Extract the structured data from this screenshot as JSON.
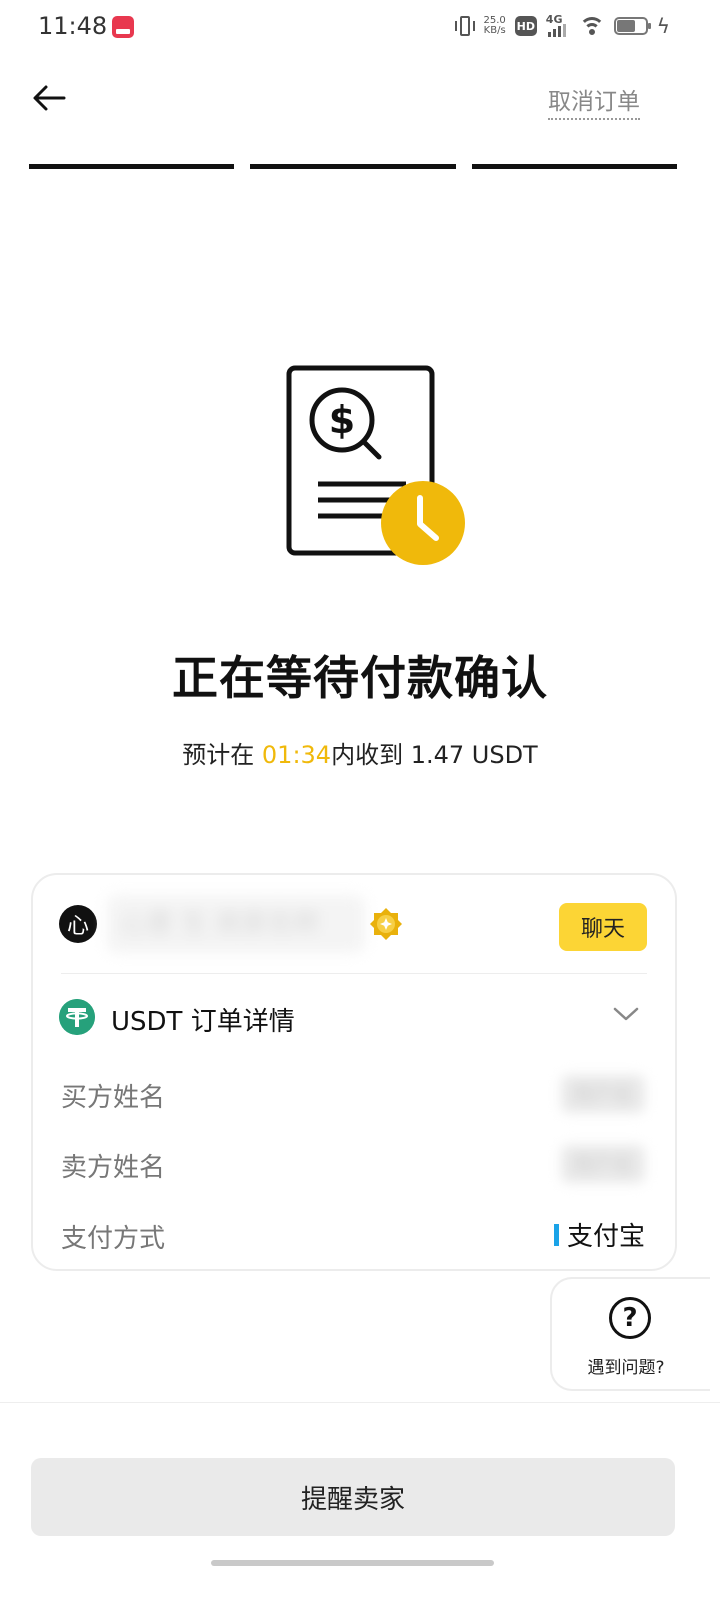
{
  "status_bar": {
    "time": "11:48",
    "net_speed_value": "25.0",
    "net_speed_unit": "KB/s",
    "hd_label": "HD",
    "network_type": "4G",
    "icons": [
      "app-icon",
      "vibrate-icon",
      "hd-icon",
      "signal-4g-icon",
      "wifi-icon",
      "battery-icon",
      "charging-icon"
    ]
  },
  "header": {
    "back_icon": "arrow-left-icon",
    "cancel_order_label": "取消订单"
  },
  "progress": {
    "total_steps": 3,
    "completed_steps": 3
  },
  "status": {
    "illustration_icon": "document-dollar-search-clock-icon",
    "title": "正在等待付款确认",
    "subtitle_prefix": "预计在 ",
    "countdown": "01:34",
    "subtitle_suffix": "内收到 1.47 USDT"
  },
  "order_card": {
    "merchant": {
      "avatar_char": "心",
      "name": "心意 生 商家名称",
      "verified_icon": "verified-badge-icon",
      "chat_label": "聊天"
    },
    "details_header": {
      "coin_icon": "usdt-icon",
      "title": "USDT 订单详情",
      "toggle_icon": "chevron-down-icon"
    },
    "rows": [
      {
        "label": "买方姓名",
        "value": "用户名"
      },
      {
        "label": "卖方姓名",
        "value": "用户名"
      },
      {
        "label": "支付方式",
        "value": "支付宝"
      }
    ]
  },
  "help": {
    "icon": "question-circle-icon",
    "label": "遇到问题?"
  },
  "footer": {
    "remind_seller_label": "提醒卖家"
  },
  "colors": {
    "accent_yellow": "#F0B90B",
    "chat_button_bg": "#FCD535",
    "usdt_green": "#26A17B",
    "alipay_blue": "#1AA3E8",
    "primary_text": "#111111",
    "secondary_text": "#777777"
  }
}
